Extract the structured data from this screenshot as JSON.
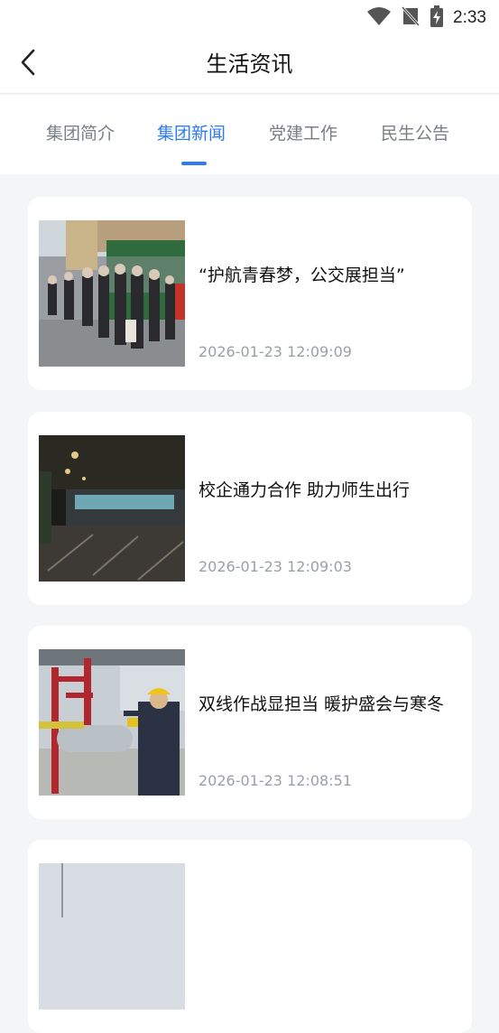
{
  "status_bar": {
    "time": "2:33",
    "icons": [
      "wifi-icon",
      "no-signal-icon",
      "battery-charging-icon"
    ]
  },
  "header": {
    "title": "生活资讯",
    "back_icon": "back-chevron-icon"
  },
  "tabs": [
    {
      "label": "集团简介",
      "active": false
    },
    {
      "label": "集团新闻",
      "active": true
    },
    {
      "label": "党建工作",
      "active": false
    },
    {
      "label": "民生公告",
      "active": false
    }
  ],
  "colors": {
    "accent": "#2f7bf5",
    "background": "#f4f5f7",
    "date_text": "#9aa0a8"
  },
  "news": [
    {
      "title": "“护航青春梦，公交展担当”",
      "date": "2026-01-23 12:09:09",
      "thumb": "students-boarding-bus-photo"
    },
    {
      "title": "校企通力合作 助力师生出行",
      "date": "2026-01-23 12:09:03",
      "thumb": "night-bus-rain-photo"
    },
    {
      "title": "双线作战显担当 暖护盛会与寒冬",
      "date": "2026-01-23 12:08:51",
      "thumb": "worker-gas-station-photo"
    },
    {
      "title": "",
      "date": "",
      "thumb": "sky-photo"
    }
  ]
}
